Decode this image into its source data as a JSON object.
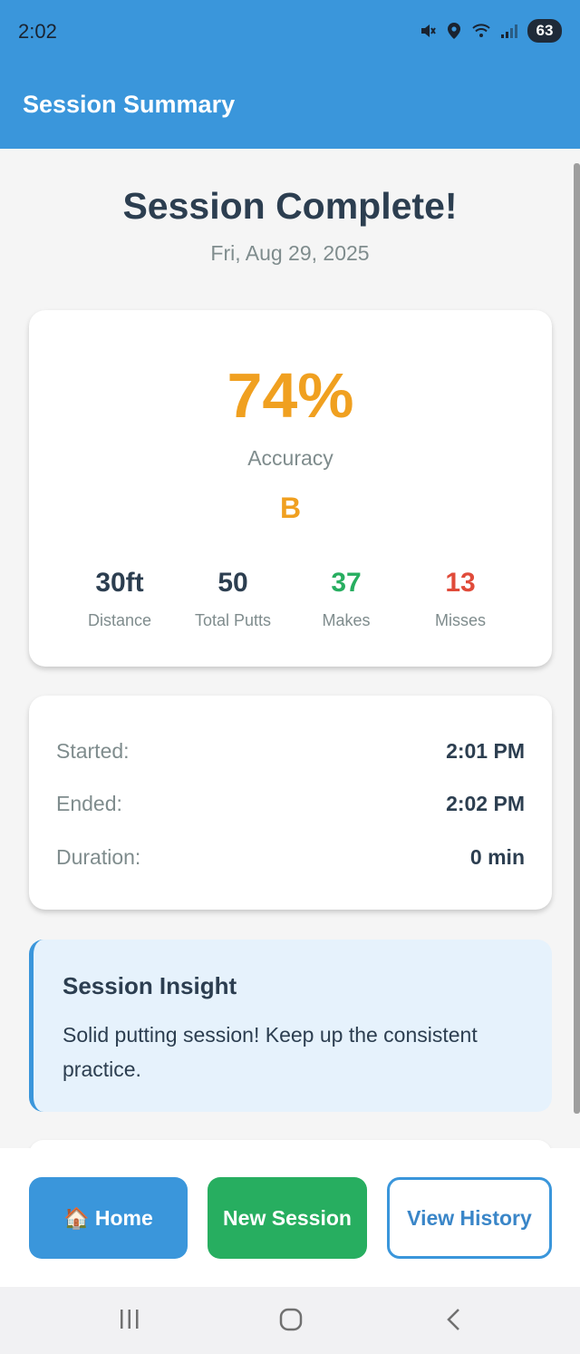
{
  "status_bar": {
    "time": "2:02",
    "battery": "63",
    "icons": [
      "mute-icon",
      "location-icon",
      "wifi-icon",
      "signal-icon",
      "battery-icon"
    ]
  },
  "app_bar": {
    "title": "Session Summary"
  },
  "header": {
    "title": "Session Complete!",
    "date": "Fri, Aug 29, 2025"
  },
  "score": {
    "accuracy": "74%",
    "accuracy_label": "Accuracy",
    "grade": "B",
    "stats": [
      {
        "value": "30ft",
        "label": "Distance",
        "color": "#2c3e50"
      },
      {
        "value": "50",
        "label": "Total Putts",
        "color": "#2c3e50"
      },
      {
        "value": "37",
        "label": "Makes",
        "color": "#27ae60"
      },
      {
        "value": "13",
        "label": "Misses",
        "color": "#e04b3a"
      }
    ]
  },
  "times": [
    {
      "label": "Started:",
      "value": "2:01 PM"
    },
    {
      "label": "Ended:",
      "value": "2:02 PM"
    },
    {
      "label": "Duration:",
      "value": "0 min"
    }
  ],
  "insight": {
    "title": "Session Insight",
    "text": "Solid putting session! Keep up the consistent practice."
  },
  "actions": {
    "home_icon": "🏠",
    "home_label": "Home",
    "new_session_label": "New Session",
    "view_history_label": "View History"
  },
  "colors": {
    "primary": "#3a96db",
    "accent": "#f0a020",
    "success": "#27ae60",
    "danger": "#e04b3a",
    "text": "#2c3e50",
    "muted": "#7f8c8d"
  }
}
